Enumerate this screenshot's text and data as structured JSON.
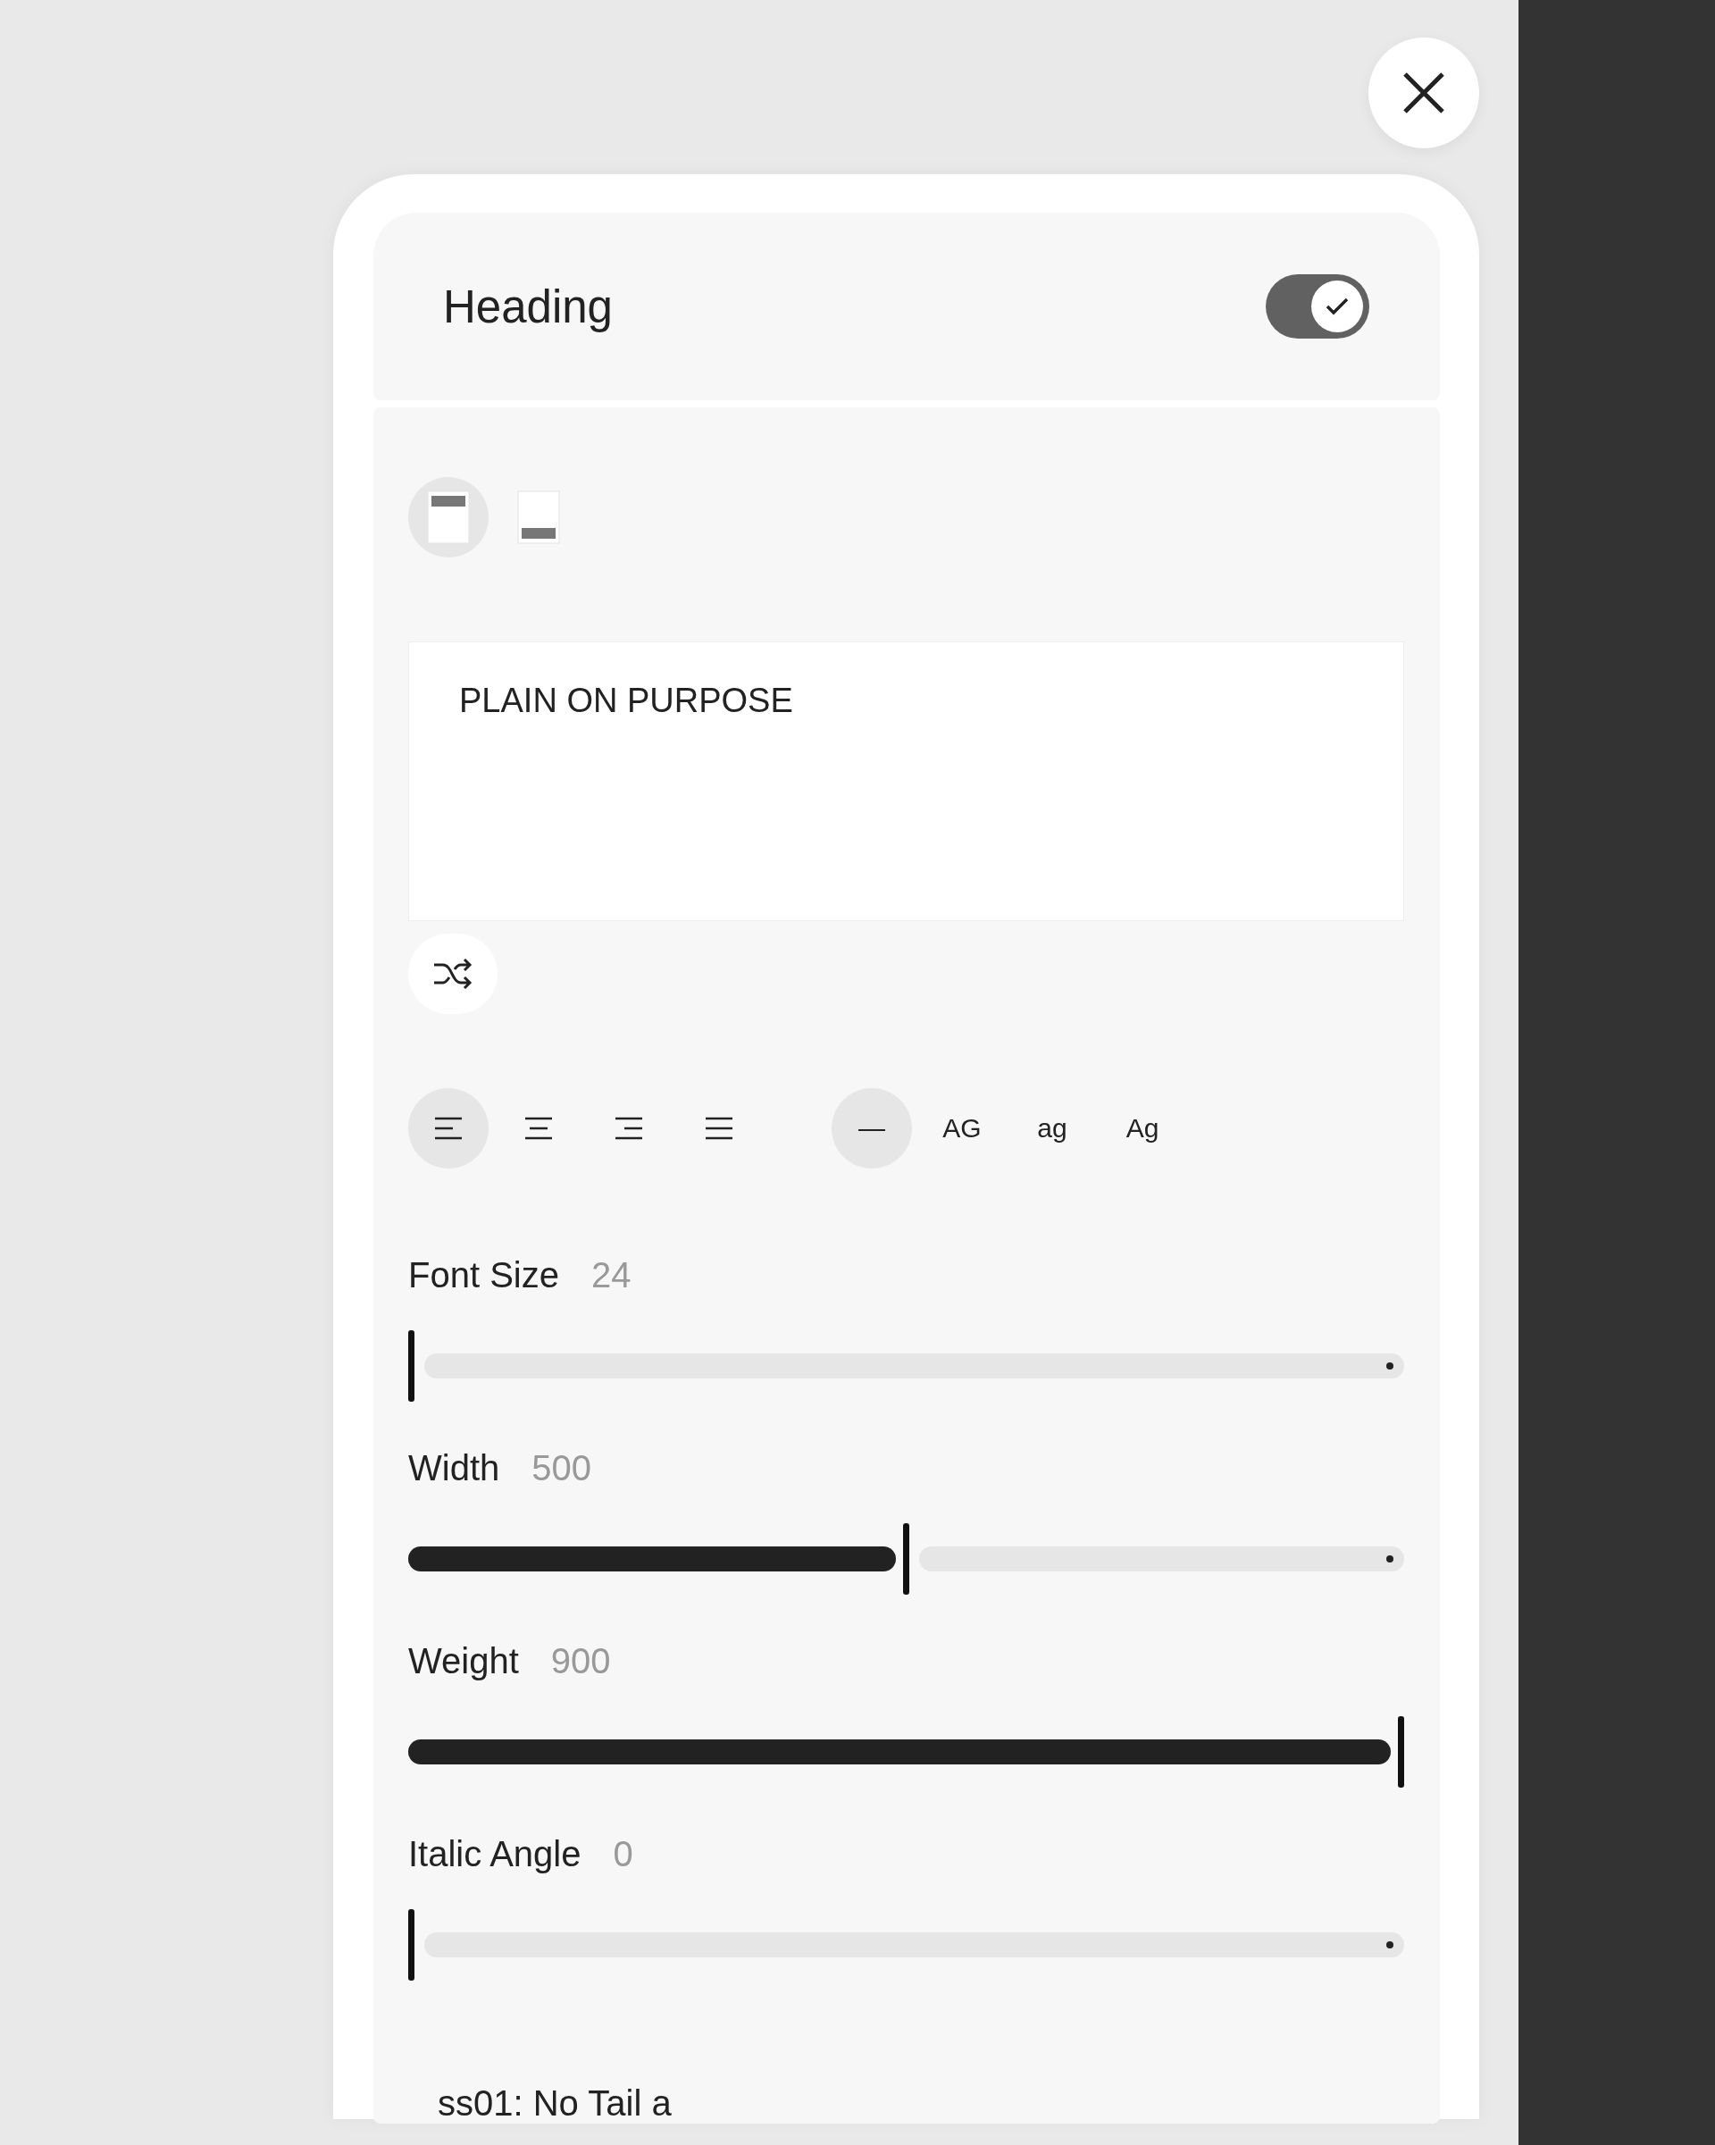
{
  "header": {
    "title": "Heading",
    "on": true
  },
  "positions": [
    {
      "kind": "top",
      "selected": true
    },
    {
      "kind": "bottom",
      "selected": false
    }
  ],
  "text_field": {
    "value": "PLAIN ON PURPOSE"
  },
  "alignments": [
    {
      "kind": "left",
      "selected": true
    },
    {
      "kind": "center",
      "selected": false
    },
    {
      "kind": "right",
      "selected": false
    },
    {
      "kind": "justify",
      "selected": false
    }
  ],
  "cases": [
    {
      "label": "—",
      "selected": true
    },
    {
      "label": "AG",
      "selected": false
    },
    {
      "label": "ag",
      "selected": false
    },
    {
      "label": "Ag",
      "selected": false
    }
  ],
  "sliders": [
    {
      "label": "Font Size",
      "reading": "24",
      "level": 0
    },
    {
      "label": "Width",
      "reading": "500",
      "level": 0.5
    },
    {
      "label": "Weight",
      "reading": "900",
      "level": 1
    },
    {
      "label": "Italic Angle",
      "reading": "0",
      "level": 0
    }
  ],
  "feature": {
    "label": "ss01: No Tail a"
  }
}
